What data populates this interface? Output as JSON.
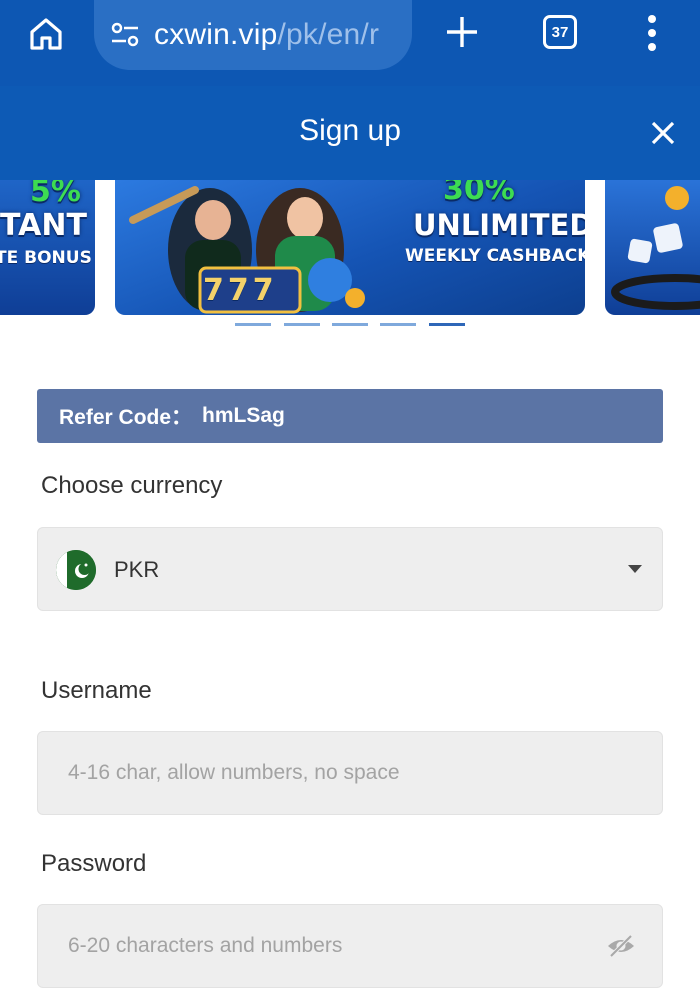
{
  "browser": {
    "url_host": "cxwin.vip",
    "url_path": "/pk/en/r",
    "tab_count": "37"
  },
  "modal": {
    "title": "Sign up"
  },
  "banner": {
    "slides": [
      {
        "line1": "5%",
        "line2": "TANT",
        "line3": "TE BONUS"
      },
      {
        "line1": "30%",
        "line2": "UNLIMITED",
        "line3": "WEEKLY CASHBACK",
        "reels": "777"
      },
      {
        "line1": "",
        "line2": "",
        "line3": ""
      }
    ],
    "dot_count": 5,
    "active_dot": 4
  },
  "form": {
    "refer_label": "Refer Code：",
    "refer_code": "hmLSag",
    "currency_label": "Choose currency",
    "currency_value": "PKR",
    "username_label": "Username",
    "username_placeholder": "4-16 char, allow numbers, no space",
    "password_label": "Password",
    "password_placeholder": "6-20 characters and numbers"
  },
  "colors": {
    "browser_bar": "#0d57b3",
    "header": "#0d5ab5",
    "refer_bar": "#5b74a5",
    "field_bg": "#eeeeee"
  }
}
